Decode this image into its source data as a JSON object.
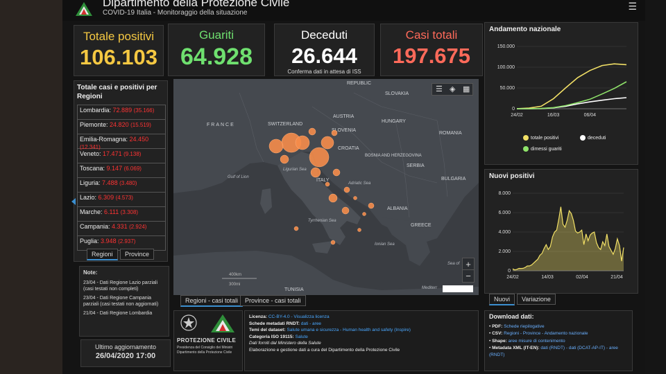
{
  "header": {
    "title": "Dipartimento della Protezione Civile",
    "subtitle": "COVID-19 Italia - Monitoraggio della situazione"
  },
  "stats": {
    "positivi": {
      "label": "Totale positivi",
      "value": "106.103",
      "color": "#f5c842"
    },
    "guariti": {
      "label": "Guariti",
      "value": "64.928",
      "color": "#6fe06f"
    },
    "deceduti": {
      "label": "Deceduti",
      "value": "26.644",
      "note": "Conferma dati in attesa di ISS",
      "color": "#ffffff"
    },
    "casi": {
      "label": "Casi totali",
      "value": "197.675",
      "color": "#ff6a5a"
    }
  },
  "regions_panel": {
    "title": "Totale casi e positivi per Regioni",
    "rows": [
      {
        "name": "Lombardia:",
        "total": "72.889",
        "positive": "(35.166)"
      },
      {
        "name": "Piemonte:",
        "total": "24.820",
        "positive": "(15.519)"
      },
      {
        "name": "Emilia-Romagna:",
        "total": "24.450",
        "positive": "(12.341)"
      },
      {
        "name": "Veneto:",
        "total": "17.471",
        "positive": "(9.138)"
      },
      {
        "name": "Toscana:",
        "total": "9.147",
        "positive": "(6.069)"
      },
      {
        "name": "Liguria:",
        "total": "7.488",
        "positive": "(3.480)"
      },
      {
        "name": "Lazio:",
        "total": "6.309",
        "positive": "(4.573)"
      },
      {
        "name": "Marche:",
        "total": "6.111",
        "positive": "(3.308)"
      },
      {
        "name": "Campania:",
        "total": "4.331",
        "positive": "(2.924)"
      },
      {
        "name": "Puglia:",
        "total": "3.948",
        "positive": "(2.937)"
      }
    ],
    "tabs": [
      "Regioni",
      "Province"
    ]
  },
  "notes": {
    "title": "Note:",
    "lines": [
      "23/04 - Dati Regione Lazio parziali (casi testati non completi)",
      "23/04 - Dati Regione Campania parziali (casi testati non aggiornati)",
      "21/04 - Dati Regione Lombardia"
    ]
  },
  "update": {
    "label": "Ultimo aggiornamento",
    "value": "26/04/2020 17:00"
  },
  "map": {
    "labels": {
      "france": "FRANCE",
      "switzerland": "SWITZERLAND",
      "austria": "AUSTRIA",
      "slovenia": "SLOVENIA",
      "croatia": "CROATIA",
      "hungary": "HUNGARY",
      "slovakia": "SLOVAKIA",
      "republic": "REPUBLIC",
      "romania": "ROMANIA",
      "bosnia": "BOSNIA AND HERZEGOVINA",
      "serbia": "SERBIA",
      "bulgaria": "BULGARIA",
      "italy": "ITALY",
      "albania": "ALBANIA",
      "greece": "GREECE",
      "ligurian": "Ligurian Sea",
      "adriatic": "Adriatic Sea",
      "tyrrhenian": "Tyrrhenian Sea",
      "ionian": "Ionian Sea",
      "gulf": "Gulf of Lion",
      "tunisia": "TUNISIA",
      "mediterr": "Mediterr",
      "sea_of": "Sea of",
      "scale_km": "400km",
      "scale_mi": "300mi"
    },
    "tabs": [
      "Regioni - casi totali",
      "Province - casi totali"
    ],
    "zoom_in": "+",
    "zoom_out": "−"
  },
  "chart_andamento": {
    "title": "Andamento nazionale",
    "chart_data": {
      "type": "line",
      "x": [
        "24/02",
        "01/03",
        "08/03",
        "16/03",
        "23/03",
        "30/03",
        "06/04",
        "13/04",
        "20/04",
        "26/04"
      ],
      "xticks": [
        "24/02",
        "16/03",
        "06/04"
      ],
      "yticks": [
        "150.000",
        "100.000",
        "50.000",
        "0"
      ],
      "ylim": [
        0,
        150000
      ],
      "series": [
        {
          "name": "totale positivi",
          "color": "#f2e066",
          "values": [
            200,
            1500,
            6000,
            24000,
            50000,
            75000,
            92000,
            104000,
            108000,
            106000
          ]
        },
        {
          "name": "deceduti",
          "color": "#ffffff",
          "values": [
            7,
            34,
            366,
            2158,
            6077,
            11591,
            16523,
            20465,
            24114,
            26644
          ]
        },
        {
          "name": "dimessi guariti",
          "color": "#8fe36a",
          "values": [
            1,
            83,
            622,
            2749,
            7432,
            14620,
            22837,
            35435,
            48877,
            64928
          ]
        }
      ]
    }
  },
  "chart_nuovi": {
    "title": "Nuovi positivi",
    "chart_data": {
      "type": "area",
      "xticks": [
        "24/02",
        "14/03",
        "02/04",
        "21/04"
      ],
      "yticks": [
        "8.000",
        "6.000",
        "4.000",
        "2.000",
        "0"
      ],
      "ylim": [
        0,
        8000
      ],
      "color": "#f2e066",
      "values": [
        200,
        90,
        150,
        250,
        240,
        260,
        350,
        500,
        500,
        600,
        800,
        1000,
        1200,
        1600,
        1800,
        2300,
        2700,
        2200,
        2500,
        3500,
        4000,
        4200,
        5300,
        6600,
        4800,
        4500,
        5200,
        6200,
        5900,
        5200,
        4100,
        3900,
        4000,
        4200,
        2700,
        3800,
        3100,
        3700,
        3900,
        4000,
        2900,
        2400,
        2200,
        3000,
        2600,
        3800,
        2500,
        2100,
        1700,
        2300,
        3300,
        2600,
        1000,
        2400
      ]
    },
    "tabs": [
      "Nuovi",
      "Variazione"
    ]
  },
  "info": {
    "lines": [
      {
        "label": "Licenza:",
        "text": "CC-BY-4.0 - Visualizza licenza"
      },
      {
        "label": "Schede metadati RNDT:",
        "text": "dati - aree"
      },
      {
        "label": "Temi del dataset:",
        "text": "Salute umana e sicurezza - Human health and safety (Inspire)"
      },
      {
        "label": "Categoria ISO 19115:",
        "text": "Salute"
      },
      {
        "label": "",
        "text": "Dati forniti dal Ministero della Salute"
      },
      {
        "label": "",
        "text": "Elaborazione e gestione dati a cura del Dipartimento della Protezione Civile"
      }
    ]
  },
  "pc_logo": {
    "name": "PROTEZIONE CIVILE",
    "sub1": "Presidenza del Consiglio dei Ministri",
    "sub2": "Dipartimento della Protezione Civile"
  },
  "download": {
    "title": "Download dati:",
    "items": [
      {
        "label": "PDF:",
        "text": "Schede riepilogative"
      },
      {
        "label": "CSV:",
        "text": "Regioni - Province - Andamento nazionale"
      },
      {
        "label": "Shape:",
        "text": "aree misure di contenimento"
      },
      {
        "label": "Metadata XML (IT-EN):",
        "text": "dati (RNDT) - dati (DCAT-AP-IT) - aree (RNDT)"
      }
    ]
  }
}
